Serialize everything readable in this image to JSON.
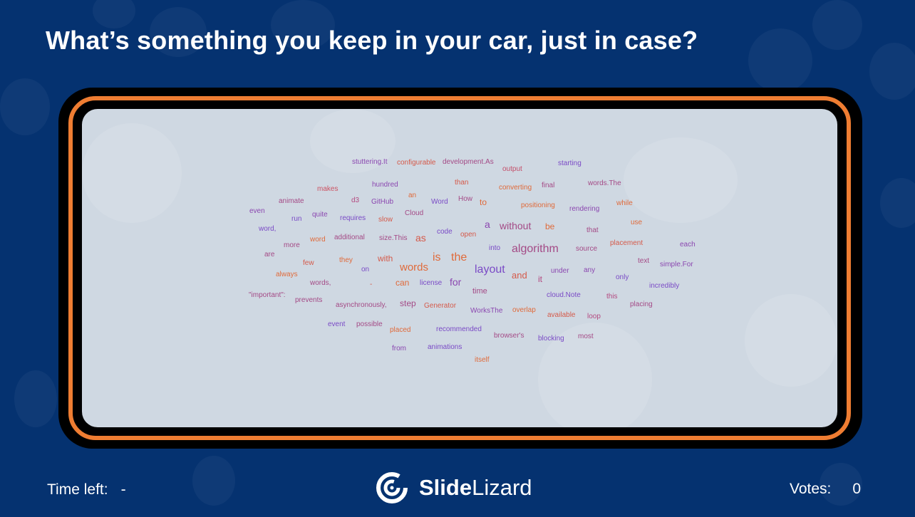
{
  "slide": {
    "question": "What’s something you keep in your car, just in case?"
  },
  "footer": {
    "time_left_label": "Time left:",
    "time_left_value": "-",
    "brand_bold": "Slide",
    "brand_regular": "Lizard",
    "votes_label": "Votes:",
    "votes_value": "0"
  },
  "colors": {
    "background": "#053270",
    "frame_accent": "#ef7d32",
    "canvas": "#cfd8e2"
  },
  "word_cloud": {
    "words": [
      {
        "text": "stuttering.It",
        "color": "#8b47b0",
        "size": 10
      },
      {
        "text": "configurable",
        "color": "#d55a4a",
        "size": 10
      },
      {
        "text": "development.As",
        "color": "#a44a86",
        "size": 10
      },
      {
        "text": "output",
        "color": "#c44f6a",
        "size": 10
      },
      {
        "text": "starting",
        "color": "#7a4ac6",
        "size": 10
      },
      {
        "text": "hundred",
        "color": "#8b47b0",
        "size": 10
      },
      {
        "text": "than",
        "color": "#d55a4a",
        "size": 10
      },
      {
        "text": "makes",
        "color": "#cc5262",
        "size": 10
      },
      {
        "text": "an",
        "color": "#e06a3a",
        "size": 10
      },
      {
        "text": "converting",
        "color": "#e06a3a",
        "size": 10
      },
      {
        "text": "final",
        "color": "#a44a86",
        "size": 10
      },
      {
        "text": "words.The",
        "color": "#a44a86",
        "size": 10
      },
      {
        "text": "animate",
        "color": "#a44a86",
        "size": 10
      },
      {
        "text": "d3",
        "color": "#b44a80",
        "size": 10
      },
      {
        "text": "GitHub",
        "color": "#8b47b0",
        "size": 10
      },
      {
        "text": "Word",
        "color": "#7a4ac6",
        "size": 10
      },
      {
        "text": "How",
        "color": "#a44a86",
        "size": 10
      },
      {
        "text": "to",
        "color": "#e06a3a",
        "size": 12
      },
      {
        "text": "positioning",
        "color": "#e06a3a",
        "size": 10
      },
      {
        "text": "while",
        "color": "#e06a3a",
        "size": 10
      },
      {
        "text": "even",
        "color": "#8b47b0",
        "size": 10
      },
      {
        "text": "Cloud",
        "color": "#a44a86",
        "size": 10
      },
      {
        "text": "rendering",
        "color": "#8b47b0",
        "size": 10
      },
      {
        "text": "run",
        "color": "#7a4ac6",
        "size": 10
      },
      {
        "text": "quite",
        "color": "#8b47b0",
        "size": 10
      },
      {
        "text": "requires",
        "color": "#7a4ac6",
        "size": 10
      },
      {
        "text": "slow",
        "color": "#d55a4a",
        "size": 10
      },
      {
        "text": "a",
        "color": "#8b47b0",
        "size": 14
      },
      {
        "text": "without",
        "color": "#a44a86",
        "size": 14
      },
      {
        "text": "be",
        "color": "#e06a3a",
        "size": 12
      },
      {
        "text": "use",
        "color": "#e06a3a",
        "size": 10
      },
      {
        "text": "word,",
        "color": "#7a4ac6",
        "size": 10
      },
      {
        "text": "code",
        "color": "#7a4ac6",
        "size": 10
      },
      {
        "text": "that",
        "color": "#a44a86",
        "size": 10
      },
      {
        "text": "additional",
        "color": "#a44a86",
        "size": 10
      },
      {
        "text": "word",
        "color": "#e06a3a",
        "size": 10
      },
      {
        "text": "size.This",
        "color": "#a44a86",
        "size": 10
      },
      {
        "text": "as",
        "color": "#d55a4a",
        "size": 14
      },
      {
        "text": "open",
        "color": "#d55a4a",
        "size": 10
      },
      {
        "text": "placement",
        "color": "#d55a4a",
        "size": 10
      },
      {
        "text": "more",
        "color": "#a44a86",
        "size": 10
      },
      {
        "text": "each",
        "color": "#8b47b0",
        "size": 10
      },
      {
        "text": "into",
        "color": "#7a4ac6",
        "size": 10
      },
      {
        "text": "algorithm",
        "color": "#a44a86",
        "size": 16
      },
      {
        "text": "source",
        "color": "#a44a86",
        "size": 10
      },
      {
        "text": "are",
        "color": "#a44a86",
        "size": 10
      },
      {
        "text": "is",
        "color": "#e06a3a",
        "size": 16
      },
      {
        "text": "the",
        "color": "#e06a3a",
        "size": 16
      },
      {
        "text": "with",
        "color": "#d55a4a",
        "size": 12
      },
      {
        "text": "they",
        "color": "#e06a3a",
        "size": 10
      },
      {
        "text": "few",
        "color": "#d55a4a",
        "size": 10
      },
      {
        "text": "words",
        "color": "#e06a3a",
        "size": 15
      },
      {
        "text": "text",
        "color": "#a44a86",
        "size": 10
      },
      {
        "text": "simple.For",
        "color": "#8b47b0",
        "size": 10
      },
      {
        "text": "layout",
        "color": "#7a4ac6",
        "size": 16
      },
      {
        "text": "on",
        "color": "#7a4ac6",
        "size": 10
      },
      {
        "text": "under",
        "color": "#8b47b0",
        "size": 10
      },
      {
        "text": "any",
        "color": "#8b47b0",
        "size": 10
      },
      {
        "text": "always",
        "color": "#e06a3a",
        "size": 10
      },
      {
        "text": "and",
        "color": "#d55a4a",
        "size": 13
      },
      {
        "text": "only",
        "color": "#7a4ac6",
        "size": 10
      },
      {
        "text": "it",
        "color": "#b44a80",
        "size": 12
      },
      {
        "text": "for",
        "color": "#8b47b0",
        "size": 14
      },
      {
        "text": "words,",
        "color": "#a44a86",
        "size": 10
      },
      {
        "text": "-",
        "color": "#d55a4a",
        "size": 10
      },
      {
        "text": "can",
        "color": "#e06a3a",
        "size": 12
      },
      {
        "text": "license",
        "color": "#7a4ac6",
        "size": 10
      },
      {
        "text": "incredibly",
        "color": "#7a4ac6",
        "size": 10
      },
      {
        "text": "time",
        "color": "#a44a86",
        "size": 11
      },
      {
        "text": "\"important\":",
        "color": "#a44a86",
        "size": 10
      },
      {
        "text": "cloud.Note",
        "color": "#7a4ac6",
        "size": 10
      },
      {
        "text": "this",
        "color": "#b44a80",
        "size": 10
      },
      {
        "text": "prevents",
        "color": "#a44a86",
        "size": 10
      },
      {
        "text": "placing",
        "color": "#a44a86",
        "size": 10
      },
      {
        "text": "asynchronously,",
        "color": "#a44a86",
        "size": 10
      },
      {
        "text": "step",
        "color": "#a44a86",
        "size": 12
      },
      {
        "text": "Generator",
        "color": "#d55a4a",
        "size": 10
      },
      {
        "text": "WorksThe",
        "color": "#8b47b0",
        "size": 10
      },
      {
        "text": "overlap",
        "color": "#e06a3a",
        "size": 10
      },
      {
        "text": "available",
        "color": "#d55a4a",
        "size": 10
      },
      {
        "text": "loop",
        "color": "#b44a80",
        "size": 10
      },
      {
        "text": "event",
        "color": "#7a4ac6",
        "size": 10
      },
      {
        "text": "possible",
        "color": "#a44a86",
        "size": 10
      },
      {
        "text": "placed",
        "color": "#e06a3a",
        "size": 10
      },
      {
        "text": "recommended",
        "color": "#7a4ac6",
        "size": 10
      },
      {
        "text": "browser's",
        "color": "#a44a86",
        "size": 10
      },
      {
        "text": "blocking",
        "color": "#7a4ac6",
        "size": 10
      },
      {
        "text": "most",
        "color": "#a44a86",
        "size": 10
      },
      {
        "text": "from",
        "color": "#8b47b0",
        "size": 10
      },
      {
        "text": "animations",
        "color": "#7a4ac6",
        "size": 10
      },
      {
        "text": "itself",
        "color": "#e06a3a",
        "size": 10
      }
    ]
  }
}
